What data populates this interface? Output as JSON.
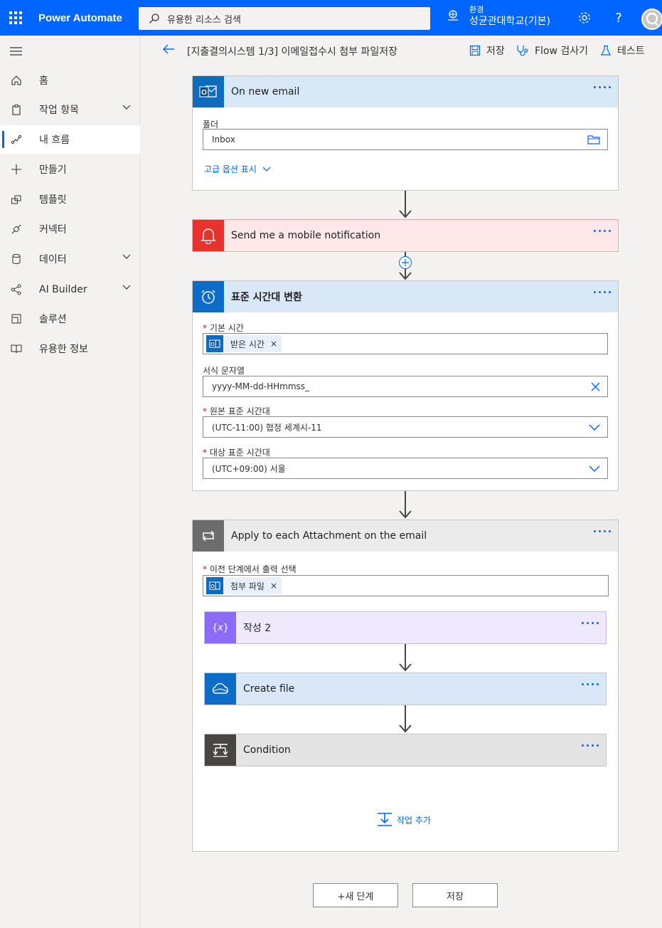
{
  "topbar": {
    "app_name": "Power Automate",
    "search_placeholder": "유용한 리소스 검색",
    "env_label": "환경",
    "env_name": "성균관대학교(기본)"
  },
  "sidebar": {
    "items": [
      {
        "label": "홈",
        "icon": "home-icon"
      },
      {
        "label": "작업 항목",
        "icon": "clipboard-icon",
        "expandable": true
      },
      {
        "label": "내 흐름",
        "icon": "flow-icon",
        "active": true
      },
      {
        "label": "만들기",
        "icon": "plus-icon"
      },
      {
        "label": "템플릿",
        "icon": "template-icon"
      },
      {
        "label": "커넥터",
        "icon": "connector-icon"
      },
      {
        "label": "데이터",
        "icon": "database-icon",
        "expandable": true
      },
      {
        "label": "AI Builder",
        "icon": "ai-builder-icon",
        "expandable": true
      },
      {
        "label": "솔루션",
        "icon": "solution-icon"
      },
      {
        "label": "유용한 정보",
        "icon": "book-icon"
      }
    ]
  },
  "cmdbar": {
    "flow_name": "[지출결의시스템 1/3] 이메일접수시 첨부 파일저장",
    "save": "저장",
    "flow_checker": "Flow 검사기",
    "test": "테스트"
  },
  "cards": {
    "trigger": {
      "title": "On new email",
      "folder_label": "폴더",
      "folder_value": "Inbox",
      "advanced_link": "고급 옵션 표시"
    },
    "notify": {
      "title": "Send me a mobile notification"
    },
    "convert": {
      "title": "표준 시간대 변환",
      "base_time_label": "기본 시간",
      "base_time_token": "받은 시간",
      "format_label": "서식 문자열",
      "format_value": "yyyy-MM-dd-HHmmss_",
      "source_tz_label": "원본 표준 시간대",
      "source_tz_value": "(UTC-11:00) 협정 세계시-11",
      "dest_tz_label": "대상 표준 시간대",
      "dest_tz_value": "(UTC+09:00) 서울"
    },
    "apply": {
      "title": "Apply to each Attachment on the email",
      "select_label": "이전 단계에서 출력 선택",
      "select_token": "첨부 파일",
      "inner": [
        {
          "title": "작성 2"
        },
        {
          "title": "Create file"
        },
        {
          "title": "Condition"
        }
      ],
      "add_action": "작업 추가"
    }
  },
  "bottom": {
    "new_step": "+새 단계",
    "save": "저장"
  },
  "colors": {
    "brand": "#0066ff",
    "outlook": "#0f6cbd",
    "notify": "#e8322d",
    "compose": "#8c6cf7",
    "onedrive": "#0d6cc7",
    "control": "#484644",
    "apply": "#6c6c6c"
  },
  "required_marker": "*",
  "token_remove": "×"
}
